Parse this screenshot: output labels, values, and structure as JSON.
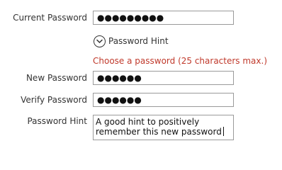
{
  "form": {
    "current_password": {
      "label": "Current Password",
      "value_masked": "●●●●●●●●●"
    },
    "hint_toggle": {
      "label": "Password Hint",
      "icon": "chevron-down-circle-icon"
    },
    "help_message": {
      "text": "Choose a password (25 characters max.)",
      "color": "#c0392b"
    },
    "new_password": {
      "label": "New Password",
      "value_masked": "●●●●●●"
    },
    "verify_password": {
      "label": "Verify Password",
      "value_masked": "●●●●●●"
    },
    "password_hint": {
      "label": "Password Hint",
      "value_line1": "A good hint to positively",
      "value_line2": "remember this new password"
    }
  },
  "colors": {
    "text": "#333333",
    "border": "#9a9a9a",
    "error": "#c0392b"
  }
}
